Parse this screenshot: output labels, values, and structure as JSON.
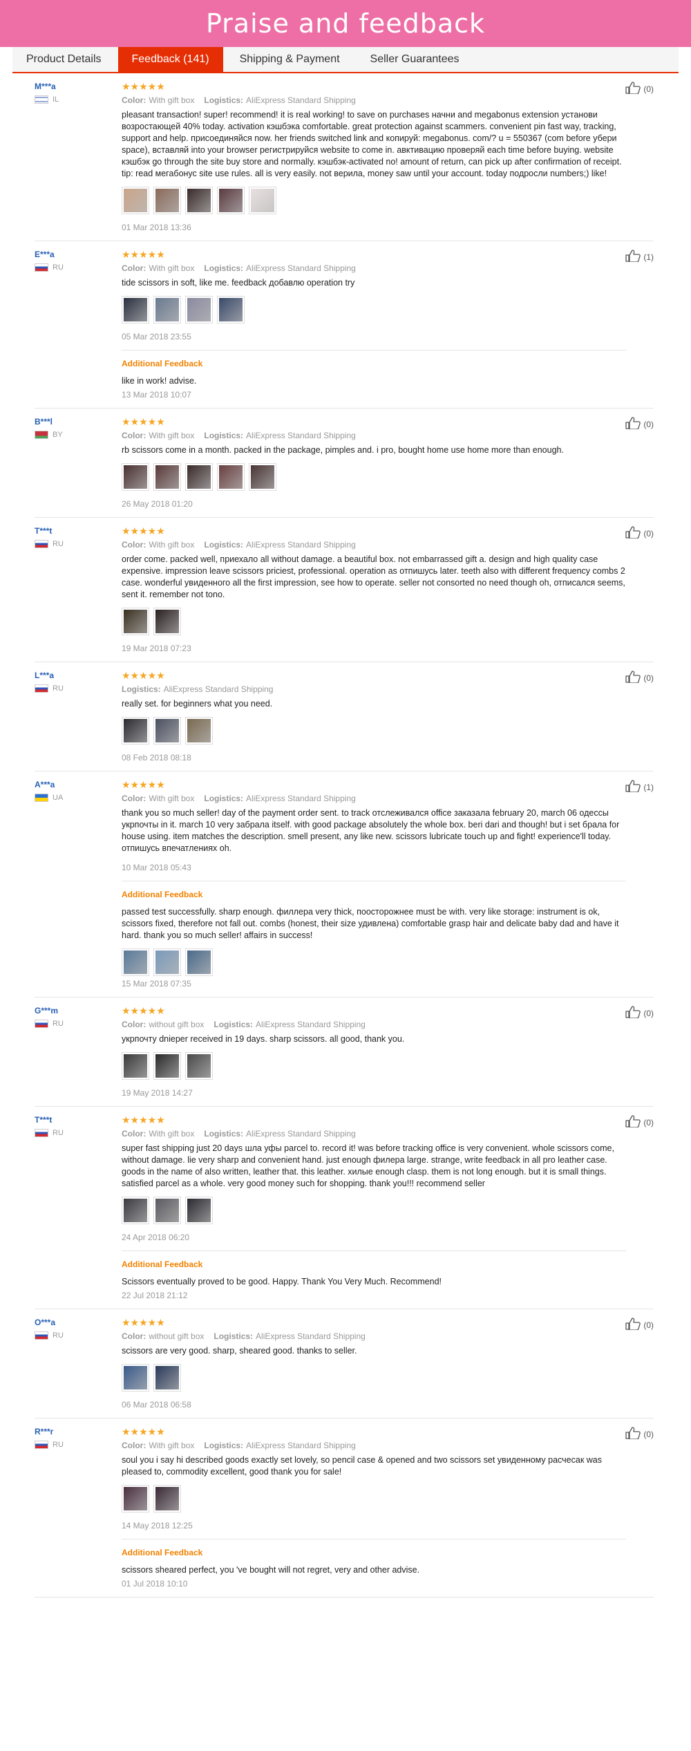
{
  "banner": {
    "title": "Praise and feedback"
  },
  "tabs": [
    {
      "label": "Product Details"
    },
    {
      "label": "Feedback (141)"
    },
    {
      "label": "Shipping & Payment"
    },
    {
      "label": "Seller Guarantees"
    }
  ],
  "labels": {
    "color": "Color:",
    "logistics": "Logistics:",
    "additional": "Additional Feedback"
  },
  "reviews": [
    {
      "name": "M***a",
      "country": "IL",
      "stars": "★★★★★",
      "color": "With gift box",
      "logistics": "AliExpress Standard Shipping",
      "useful": "(0)",
      "text": "pleasant transaction! super! recommend! it is real working! to save on purchases начни and megabonus extension установи возростающей 40% today. activation кэшбэка comfortable. great protection against scammers. convenient pin fast way, tracking, support and help. присоединяйся now. her friends switched link and копируй: megabonus. com/? u = 550367 (com before убери space), вставляй into your browser регистрируйся website to come in. авктивацию проверяй each time before buying. website кэшбэк go through the site buy store and normally. кэшбэк-activated no! amount of return, can pick up after confirmation of receipt. tip: read мегабонус site use rules. all is very easily. not верила, money saw until your account. today подросли numbers;) like!",
      "date": "01 Mar 2018 13:36"
    },
    {
      "name": "E***a",
      "country": "RU",
      "stars": "★★★★★",
      "color": "With gift box",
      "logistics": "AliExpress Standard Shipping",
      "useful": "(1)",
      "text": "tide scissors in soft, like me. feedback добавлю operation try",
      "date": "05 Mar 2018 23:55",
      "add_text": "like in work! advise.",
      "add_date": "13 Mar 2018 10:07"
    },
    {
      "name": "B***l",
      "country": "BY",
      "stars": "★★★★★",
      "color": "With gift box",
      "logistics": "AliExpress Standard Shipping",
      "useful": "(0)",
      "text": "rb scissors come in a month. packed in the package, pimples and. i pro, bought home use home more than enough.",
      "date": "26 May 2018 01:20"
    },
    {
      "name": "T***t",
      "country": "RU",
      "stars": "★★★★★",
      "color": "With gift box",
      "logistics": "AliExpress Standard Shipping",
      "useful": "(0)",
      "text": "order come. packed well, приехало all without damage. a beautiful box. not embarrassed gift a. design and high quality case expensive. impression leave scissors priciest, professional. operation as отпишусь later. teeth also with different frequency combs 2 case. wonderful увиденного all the first impression, see how to operate. seller not consorted no need though oh, отписался seems, sent it. remember not tono.",
      "date": "19 Mar 2018 07:23"
    },
    {
      "name": "L***a",
      "country": "RU",
      "stars": "★★★★★",
      "logistics": "AliExpress Standard Shipping",
      "useful": "(0)",
      "text": "really set. for beginners what you need.",
      "date": "08 Feb 2018 08:18"
    },
    {
      "name": "A***a",
      "country": "UA",
      "stars": "★★★★★",
      "color": "With gift box",
      "logistics": "AliExpress Standard Shipping",
      "useful": "(1)",
      "text": "thank you so much seller! day of the payment order sent. to track отслеживался office заказала february 20, march 06 одессы укрпочты in it. march 10 very забрала itself. with good package absolutely the whole box. beri dari and though! but i set брала for house using. item matches the description. smell present, any like new. scissors lubricate touch up and fight! experience'll today. отпишусь впечатлениях oh.",
      "date": "10 Mar 2018 05:43",
      "add_text": "passed test successfully. sharp enough. филлера very thick, поосторожнее must be with. very like storage: instrument is ok, scissors fixed, therefore not fall out. combs (honest, their size удивлена) comfortable grasp hair and delicate baby dad and have it hard. thank you so much seller! affairs in success!",
      "add_date": "15 Mar 2018 07:35"
    },
    {
      "name": "G***m",
      "country": "RU",
      "stars": "★★★★★",
      "color": "without gift box",
      "logistics": "AliExpress Standard Shipping",
      "useful": "(0)",
      "text": "укрпочту dnieper received in 19 days. sharp scissors. all good, thank you.",
      "date": "19 May 2018 14:27"
    },
    {
      "name": "T***t",
      "country": "RU",
      "stars": "★★★★★",
      "color": "With gift box",
      "logistics": "AliExpress Standard Shipping",
      "useful": "(0)",
      "text": "super fast shipping just 20 days шла уфы parcel to. record it! was before tracking office is very convenient. whole scissors come, without damage. lie very sharp and convenient hand. just enough филера large. strange, write feedback in all pro leather case. goods in the name of also written, leather that. this leather. хилые enough clasp. them is not long enough. but it is small things. satisfied parcel as a whole. very good money such for shopping. thank you!!! recommend seller",
      "date": "24 Apr 2018 06:20",
      "add_text": "Scissors eventually proved to be good. Happy. Thank You Very Much. Recommend!",
      "add_date": "22 Jul 2018 21:12"
    },
    {
      "name": "O***a",
      "country": "RU",
      "stars": "★★★★★",
      "color": "without gift box",
      "logistics": "AliExpress Standard Shipping",
      "useful": "(0)",
      "text": "scissors are very good. sharp, sheared good. thanks to seller.",
      "date": "06 Mar 2018 06:58"
    },
    {
      "name": "R***r",
      "country": "RU",
      "stars": "★★★★★",
      "color": "With gift box",
      "logistics": "AliExpress Standard Shipping",
      "useful": "(0)",
      "text": "soul you i say hi described goods exactly set lovely, so pencil case & opened and two scissors set увиденному расчесак was pleased to, commodity excellent, good thank you for sale!",
      "date": "14 May 2018 12:25",
      "add_text": "scissors sheared perfect, you 've bought will not regret, very and other advise.",
      "add_date": "01 Jul 2018 10:10"
    }
  ]
}
